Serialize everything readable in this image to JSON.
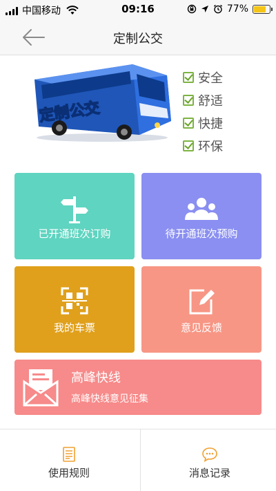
{
  "status_bar": {
    "carrier": "中国移动",
    "time": "09:16",
    "battery": "77%",
    "battery_level": 0.77
  },
  "nav": {
    "title": "定制公交"
  },
  "hero": {
    "bus_text": "定制公交",
    "features": [
      "安全",
      "舒适",
      "快捷",
      "环保"
    ],
    "check_color": "#7cb342"
  },
  "tiles": {
    "subscribe": {
      "label": "已开通班次订购",
      "color": "#5fd4c0"
    },
    "preorder": {
      "label": "待开通班次预购",
      "color": "#8a8ff1"
    },
    "tickets": {
      "label": "我的车票",
      "color": "#e0a01b"
    },
    "feedback": {
      "label": "意见反馈",
      "color": "#f79685"
    },
    "peak": {
      "title": "高峰快线",
      "subtitle": "高峰快线意见征集",
      "color": "#f78a8a"
    }
  },
  "tabbar": {
    "rules": "使用规则",
    "messages": "消息记录",
    "accent": "#f0a030"
  }
}
